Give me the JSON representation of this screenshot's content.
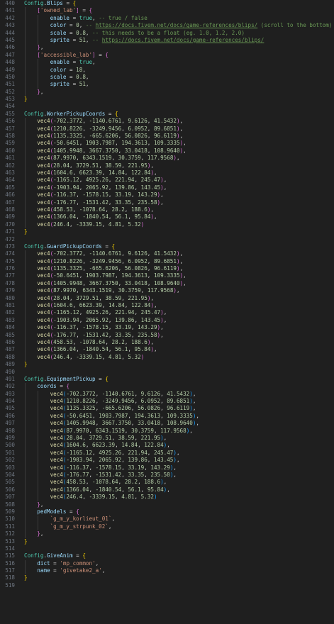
{
  "editor": {
    "lines": [
      {
        "n": "440",
        "code": "Config.Blips = {"
      },
      {
        "n": "441",
        "code": "    ['owned_lab'] = {"
      },
      {
        "n": "442",
        "code": "        enable = true, -- true / false"
      },
      {
        "n": "443",
        "code": "        color = 0, -- https://docs.fivem.net/docs/game-references/blips/ (scroll to the bottom)"
      },
      {
        "n": "444",
        "code": "        scale = 0.8, -- this needs to be a float (eg. 1.0, 1.2, 2.0)"
      },
      {
        "n": "445",
        "code": "        sprite = 51, -- https://docs.fivem.net/docs/game-references/blips/"
      },
      {
        "n": "446",
        "code": "    },"
      },
      {
        "n": "447",
        "code": "    ['accessible_lab'] = {"
      },
      {
        "n": "448",
        "code": "        enable = true,"
      },
      {
        "n": "449",
        "code": "        color = 18,"
      },
      {
        "n": "450",
        "code": "        scale = 0.8,"
      },
      {
        "n": "451",
        "code": "        sprite = 51,"
      },
      {
        "n": "452",
        "code": "    },"
      },
      {
        "n": "453",
        "code": "}"
      },
      {
        "n": "454",
        "code": ""
      },
      {
        "n": "455",
        "code": "Config.WorkerPickupCoords = {"
      },
      {
        "n": "456",
        "code": "    vec4(-702.3772, -1140.6761, 9.6126, 41.5432),"
      },
      {
        "n": "457",
        "code": "    vec4(1210.8226, -3249.9456, 6.0952, 89.6851),"
      },
      {
        "n": "458",
        "code": "    vec4(1135.3325, -665.6206, 56.0826, 96.6119),"
      },
      {
        "n": "459",
        "code": "    vec4(-50.6451, 1903.7987, 194.3613, 109.3335),"
      },
      {
        "n": "460",
        "code": "    vec4(1405.9948, 3667.3750, 33.0418, 108.9640),"
      },
      {
        "n": "461",
        "code": "    vec4(87.9970, 6343.1519, 30.3759, 117.9568),"
      },
      {
        "n": "462",
        "code": "    vec4(28.04, 3729.51, 38.59, 221.95),"
      },
      {
        "n": "463",
        "code": "    vec4(1604.6, 6623.39, 14.84, 122.84),"
      },
      {
        "n": "464",
        "code": "    vec4(-1165.12, 4925.26, 221.94, 245.47),"
      },
      {
        "n": "465",
        "code": "    vec4(-1903.94, 2065.92, 139.86, 143.45),"
      },
      {
        "n": "466",
        "code": "    vec4(-116.37, -1578.15, 33.19, 143.29),"
      },
      {
        "n": "467",
        "code": "    vec4(-176.77, -1531.42, 33.35, 235.58),"
      },
      {
        "n": "468",
        "code": "    vec4(458.53, -1078.64, 28.2, 188.6),"
      },
      {
        "n": "469",
        "code": "    vec4(1366.04, -1840.54, 56.1, 95.84),"
      },
      {
        "n": "470",
        "code": "    vec4(246.4, -3339.15, 4.81, 5.32)"
      },
      {
        "n": "471",
        "code": "}"
      },
      {
        "n": "472",
        "code": ""
      },
      {
        "n": "473",
        "code": "Config.GuardPickupCoords = {"
      },
      {
        "n": "474",
        "code": "    vec4(-702.3772, -1140.6761, 9.6126, 41.5432),"
      },
      {
        "n": "475",
        "code": "    vec4(1210.8226, -3249.9456, 6.0952, 89.6851),"
      },
      {
        "n": "476",
        "code": "    vec4(1135.3325, -665.6206, 56.0826, 96.6119),"
      },
      {
        "n": "477",
        "code": "    vec4(-50.6451, 1903.7987, 194.3613, 109.3335),"
      },
      {
        "n": "478",
        "code": "    vec4(1405.9948, 3667.3750, 33.0418, 108.9640),"
      },
      {
        "n": "479",
        "code": "    vec4(87.9970, 6343.1519, 30.3759, 117.9568),"
      },
      {
        "n": "480",
        "code": "    vec4(28.04, 3729.51, 38.59, 221.95),"
      },
      {
        "n": "481",
        "code": "    vec4(1604.6, 6623.39, 14.84, 122.84),"
      },
      {
        "n": "482",
        "code": "    vec4(-1165.12, 4925.26, 221.94, 245.47),"
      },
      {
        "n": "483",
        "code": "    vec4(-1903.94, 2065.92, 139.86, 143.45),"
      },
      {
        "n": "484",
        "code": "    vec4(-116.37, -1578.15, 33.19, 143.29),"
      },
      {
        "n": "485",
        "code": "    vec4(-176.77, -1531.42, 33.35, 235.58),"
      },
      {
        "n": "486",
        "code": "    vec4(458.53, -1078.64, 28.2, 188.6),"
      },
      {
        "n": "487",
        "code": "    vec4(1366.04, -1840.54, 56.1, 95.84),"
      },
      {
        "n": "488",
        "code": "    vec4(246.4, -3339.15, 4.81, 5.32)"
      },
      {
        "n": "489",
        "code": "}"
      },
      {
        "n": "490",
        "code": ""
      },
      {
        "n": "491",
        "code": "Config.EquipmentPickup = {"
      },
      {
        "n": "492",
        "code": "    coords = {"
      },
      {
        "n": "493",
        "code": "        vec4(-702.3772, -1140.6761, 9.6126, 41.5432),"
      },
      {
        "n": "494",
        "code": "        vec4(1210.8226, -3249.9456, 6.0952, 89.6851),"
      },
      {
        "n": "495",
        "code": "        vec4(1135.3325, -665.6206, 56.0826, 96.6119),"
      },
      {
        "n": "496",
        "code": "        vec4(-50.6451, 1903.7987, 194.3613, 109.3335),"
      },
      {
        "n": "497",
        "code": "        vec4(1405.9948, 3667.3750, 33.0418, 108.9640),"
      },
      {
        "n": "498",
        "code": "        vec4(87.9970, 6343.1519, 30.3759, 117.9568),"
      },
      {
        "n": "499",
        "code": "        vec4(28.04, 3729.51, 38.59, 221.95),"
      },
      {
        "n": "500",
        "code": "        vec4(1604.6, 6623.39, 14.84, 122.84),"
      },
      {
        "n": "501",
        "code": "        vec4(-1165.12, 4925.26, 221.94, 245.47),"
      },
      {
        "n": "502",
        "code": "        vec4(-1903.94, 2065.92, 139.86, 143.45),"
      },
      {
        "n": "503",
        "code": "        vec4(-116.37, -1578.15, 33.19, 143.29),"
      },
      {
        "n": "504",
        "code": "        vec4(-176.77, -1531.42, 33.35, 235.58),"
      },
      {
        "n": "505",
        "code": "        vec4(458.53, -1078.64, 28.2, 188.6),"
      },
      {
        "n": "506",
        "code": "        vec4(1366.04, -1840.54, 56.1, 95.84),"
      },
      {
        "n": "507",
        "code": "        vec4(246.4, -3339.15, 4.81, 5.32)"
      },
      {
        "n": "508",
        "code": "    },"
      },
      {
        "n": "509",
        "code": "    pedModels = {"
      },
      {
        "n": "510",
        "code": "        `g_m_y_korlieut_01`,"
      },
      {
        "n": "511",
        "code": "        `g_m_y_strpunk_02`,"
      },
      {
        "n": "512",
        "code": "    },"
      },
      {
        "n": "513",
        "code": "}"
      },
      {
        "n": "514",
        "code": ""
      },
      {
        "n": "515",
        "code": "Config.GiveAnim = {"
      },
      {
        "n": "516",
        "code": "    dict = 'mp_common',"
      },
      {
        "n": "517",
        "code": "    name = 'givetake2_a',"
      },
      {
        "n": "518",
        "code": "}"
      },
      {
        "n": "519",
        "code": ""
      }
    ]
  },
  "theme": {
    "background": "#1f1f1f",
    "line_number": "#6e7681",
    "keyword": "#4ec9b0",
    "property": "#9cdcfe",
    "function": "#dcdcaa",
    "number": "#b5cea8",
    "string": "#ce9178",
    "comment": "#6a9955",
    "bracket_level_1": "#ffd700",
    "bracket_level_2": "#da70d6",
    "bracket_level_3": "#179fff"
  }
}
